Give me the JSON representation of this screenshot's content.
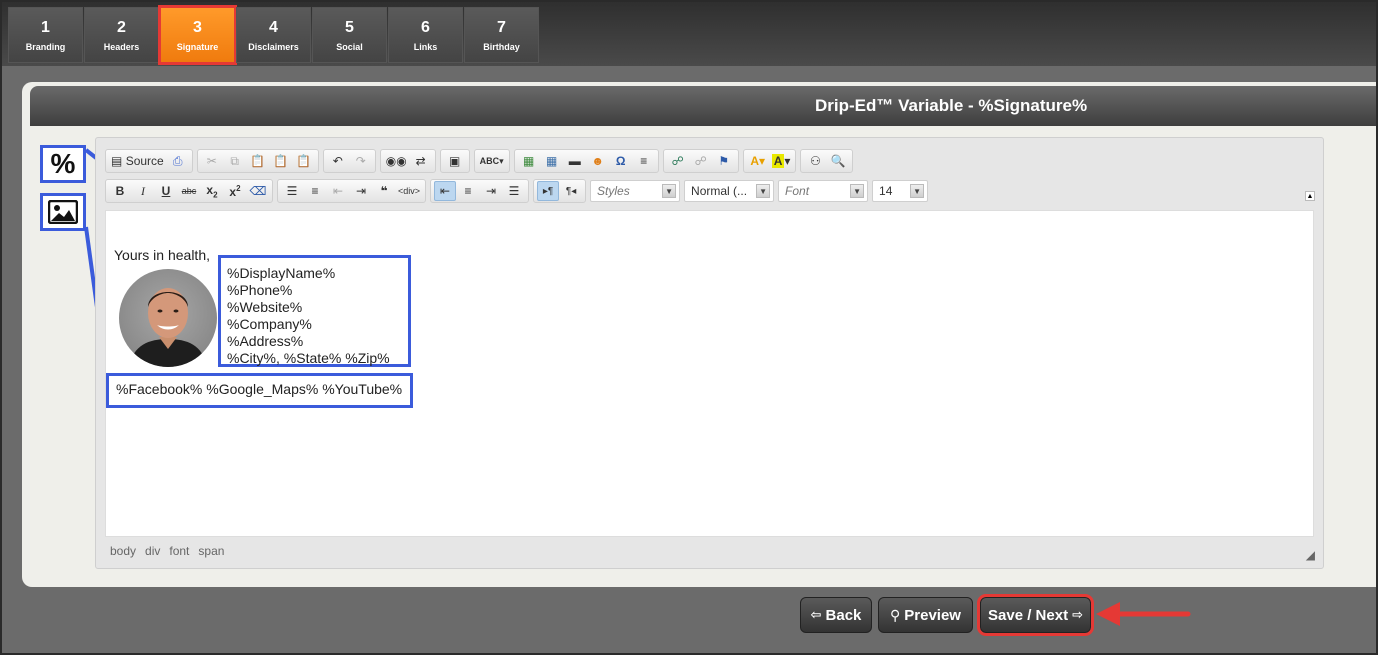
{
  "tabs": [
    {
      "num": "1",
      "label": "Branding"
    },
    {
      "num": "2",
      "label": "Headers"
    },
    {
      "num": "3",
      "label": "Signature"
    },
    {
      "num": "4",
      "label": "Disclaimers"
    },
    {
      "num": "5",
      "label": "Social"
    },
    {
      "num": "6",
      "label": "Links"
    },
    {
      "num": "7",
      "label": "Birthday"
    }
  ],
  "panel": {
    "title": "Drip-Ed™ Variable - %Signature%"
  },
  "side": {
    "percent_label": "%"
  },
  "toolbar": {
    "source_label": "Source",
    "styles_label": "Styles",
    "format_label": "Normal (...",
    "font_label": "Font",
    "size_label": "14"
  },
  "editor": {
    "greeting": "Yours in health,",
    "vars": [
      "%DisplayName%",
      "%Phone%",
      "%Website%",
      "%Company%",
      "%Address%",
      "%City%, %State% %Zip%"
    ],
    "social": "%Facebook% %Google_Maps% %YouTube%",
    "path": [
      "body",
      "div",
      "font",
      "span"
    ]
  },
  "buttons": {
    "back": "Back",
    "preview": "Preview",
    "save_next": "Save / Next"
  },
  "colors": {
    "highlight_blue": "#3b5bdb",
    "highlight_red": "#e53935",
    "active_tab": "#f07b0e"
  }
}
